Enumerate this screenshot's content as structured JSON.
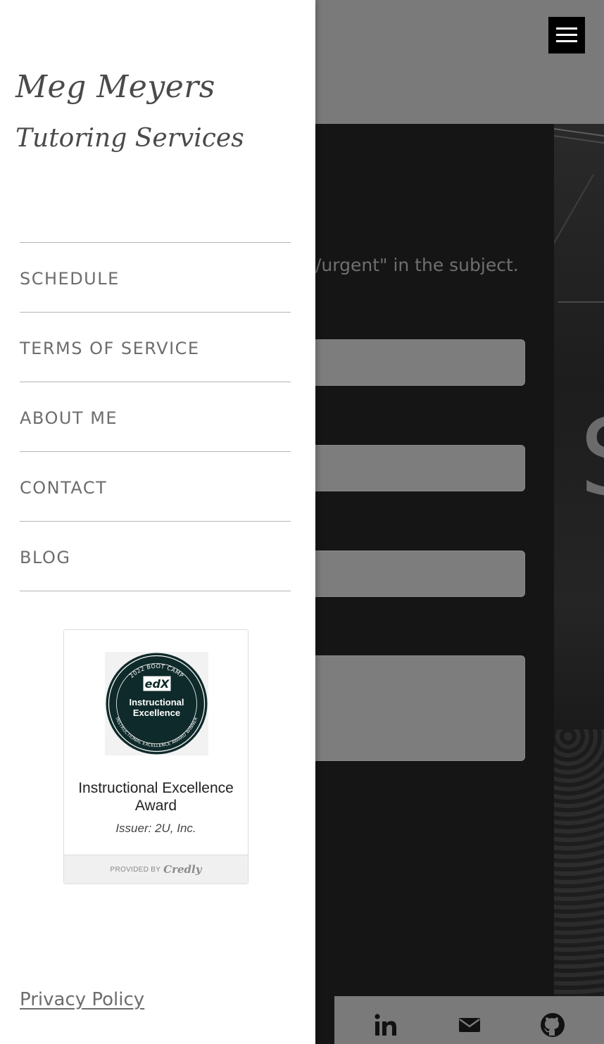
{
  "background": {
    "instruction_text": "/urgent\" in the subject.",
    "form_fields": [
      "",
      "",
      ""
    ],
    "message_field": ""
  },
  "header": {
    "menu_button": "menu"
  },
  "drawer": {
    "brand_name": "Meg Meyers",
    "brand_subtitle": "Tutoring Services",
    "nav_items": [
      {
        "label": "SCHEDULE"
      },
      {
        "label": "TERMS OF SERVICE"
      },
      {
        "label": "ABOUT ME"
      },
      {
        "label": "CONTACT"
      },
      {
        "label": "BLOG"
      }
    ],
    "badge": {
      "ring_top": "2022 BOOT CAMP",
      "logo": "edX",
      "line1": "Instructional",
      "line2": "Excellence",
      "ring_bottom": "INSTRUCTIONAL EXCELLENCE AWARD WINNER",
      "title": "Instructional Excellence Award",
      "issuer": "Issuer: 2U, Inc.",
      "provided_by": "PROVIDED BY",
      "provider": "Credly"
    },
    "privacy_link": "Privacy Policy"
  },
  "footer": {
    "icons": [
      "linkedin-icon",
      "email-icon",
      "github-icon"
    ]
  },
  "colors": {
    "drawer_bg": "#ffffff",
    "nav_text": "#6d6d6d",
    "overlay_header": "#7a7a7a",
    "badge_dark": "#0f2a2a"
  }
}
